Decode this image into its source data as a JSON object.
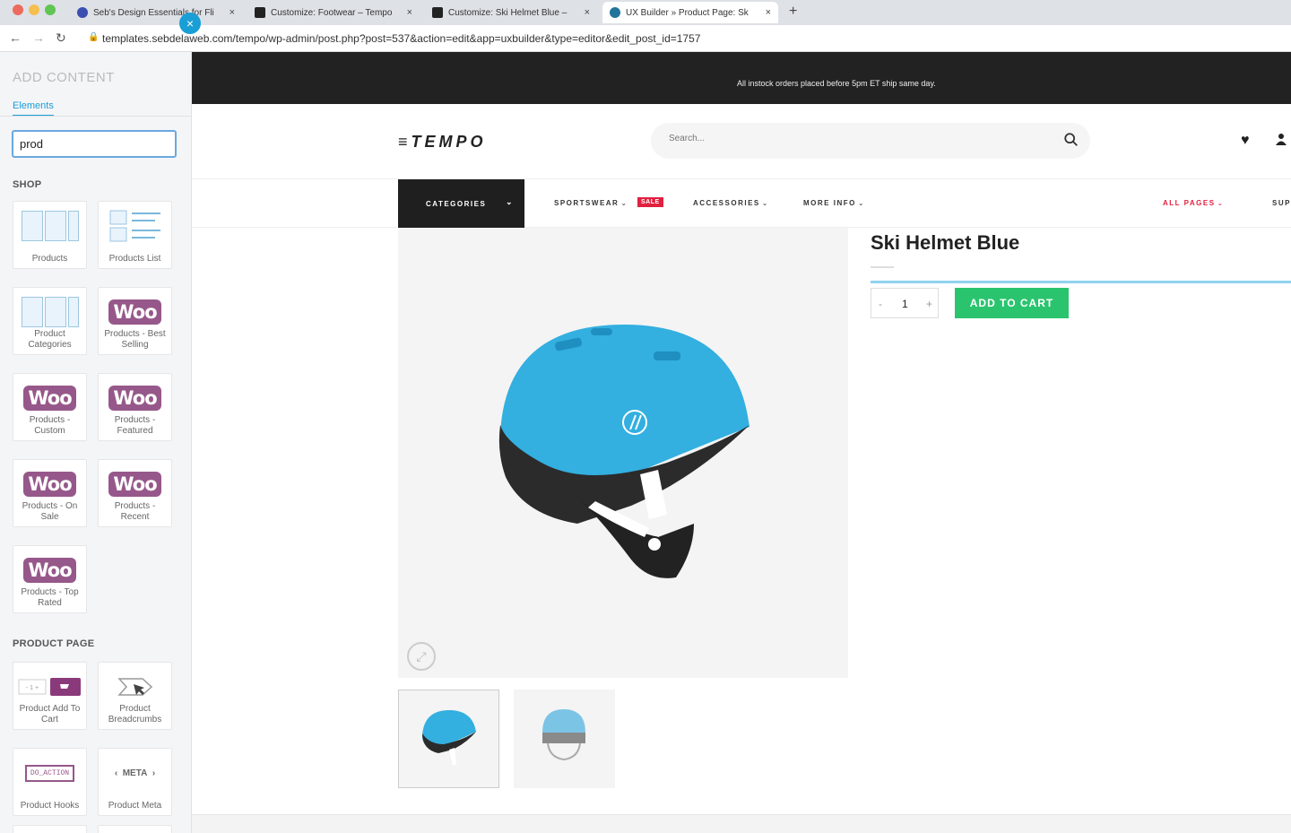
{
  "browser": {
    "tabs": [
      {
        "title": "Seb's Design Essentials for Fli",
        "active": false
      },
      {
        "title": "Customize: Footwear – Tempo",
        "active": false
      },
      {
        "title": "Customize: Ski Helmet Blue –",
        "active": false
      },
      {
        "title": "UX Builder » Product Page: Sk",
        "active": true
      }
    ],
    "url": "templates.sebdelaweb.com/tempo/wp-admin/post.php?post=537&action=edit&app=uxbuilder&type=editor&edit_post_id=1757",
    "close_glyph": "×",
    "new_tab_glyph": "+"
  },
  "panel": {
    "title": "ADD CONTENT",
    "tab": "Elements",
    "search_value": "prod",
    "close_glyph": "×",
    "shop_label": "SHOP",
    "shop_items": [
      {
        "label": "Products",
        "icon": "products-grid-icon"
      },
      {
        "label": "Products List",
        "icon": "products-list-icon"
      },
      {
        "label": "Product Categories",
        "icon": "product-categories-icon"
      },
      {
        "label": "Products - Best Selling",
        "icon": "woo-icon"
      },
      {
        "label": "Products - Custom",
        "icon": "woo-icon"
      },
      {
        "label": "Products - Featured",
        "icon": "woo-icon"
      },
      {
        "label": "Products - On Sale",
        "icon": "woo-icon"
      },
      {
        "label": "Products - Recent",
        "icon": "woo-icon"
      },
      {
        "label": "Products - Top Rated",
        "icon": "woo-icon"
      }
    ],
    "woo_text": "Woo",
    "product_page_label": "PRODUCT PAGE",
    "product_page_items": [
      {
        "label": "Product Add To Cart",
        "icon": "add-to-cart-icon"
      },
      {
        "label": "Product Breadcrumbs",
        "icon": "breadcrumbs-icon"
      },
      {
        "label": "Product Hooks",
        "icon": "hooks-icon",
        "icon_text": "DO_ACTION"
      },
      {
        "label": "Product Meta",
        "icon": "meta-icon",
        "icon_text": "META"
      }
    ]
  },
  "site": {
    "topbar_text": "All instock orders placed before 5pm ET ship same day.",
    "logo": "≡TEMPO",
    "search_placeholder": "Search...",
    "nav": {
      "categories": "CATEGORIES",
      "items": [
        "SPORTSWEAR",
        "ACCESSORIES",
        "MORE INFO",
        "ALL PAGES",
        "SUP"
      ],
      "sale_badge": "SALE"
    },
    "product": {
      "title": "Ski Helmet Blue",
      "qty_minus": "-",
      "qty_value": "1",
      "qty_plus": "+",
      "add_to_cart": "ADD TO CART"
    }
  },
  "colors": {
    "accent": "#1a9ed6",
    "woo": "#96588a",
    "add_to_cart": "#2ac46e",
    "sale": "#e0203f",
    "helmet": "#33afe0"
  }
}
